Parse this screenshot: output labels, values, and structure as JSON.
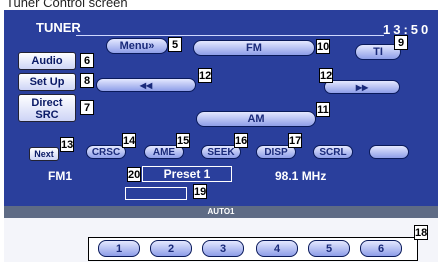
{
  "caption": "Tuner Control screen",
  "screen": {
    "title": "TUNER",
    "clock": "13:50",
    "menu_label": "Menu»",
    "band_fm": "FM",
    "ti_label": "TI",
    "band_am": "AM",
    "seek_back_label": "◀◀",
    "seek_forward_label": "▶▶"
  },
  "side": {
    "audio": "Audio",
    "setup": "Set Up",
    "direct_line1": "Direct",
    "direct_line2": "SRC",
    "next": "Next"
  },
  "function_buttons": [
    "CRSC",
    "AME",
    "SEEK",
    "DISP",
    "SCRL",
    ""
  ],
  "info": {
    "band": "FM1",
    "preset": "Preset 1",
    "frequency": "98.1 MHz"
  },
  "status": {
    "mode": "AUTO1"
  },
  "presets": [
    "1",
    "2",
    "3",
    "4",
    "5",
    "6"
  ],
  "callouts": [
    "5",
    "6",
    "7",
    "8",
    "9",
    "10",
    "11",
    "12",
    "12",
    "13",
    "14",
    "15",
    "16",
    "17",
    "18",
    "19",
    "20"
  ]
}
